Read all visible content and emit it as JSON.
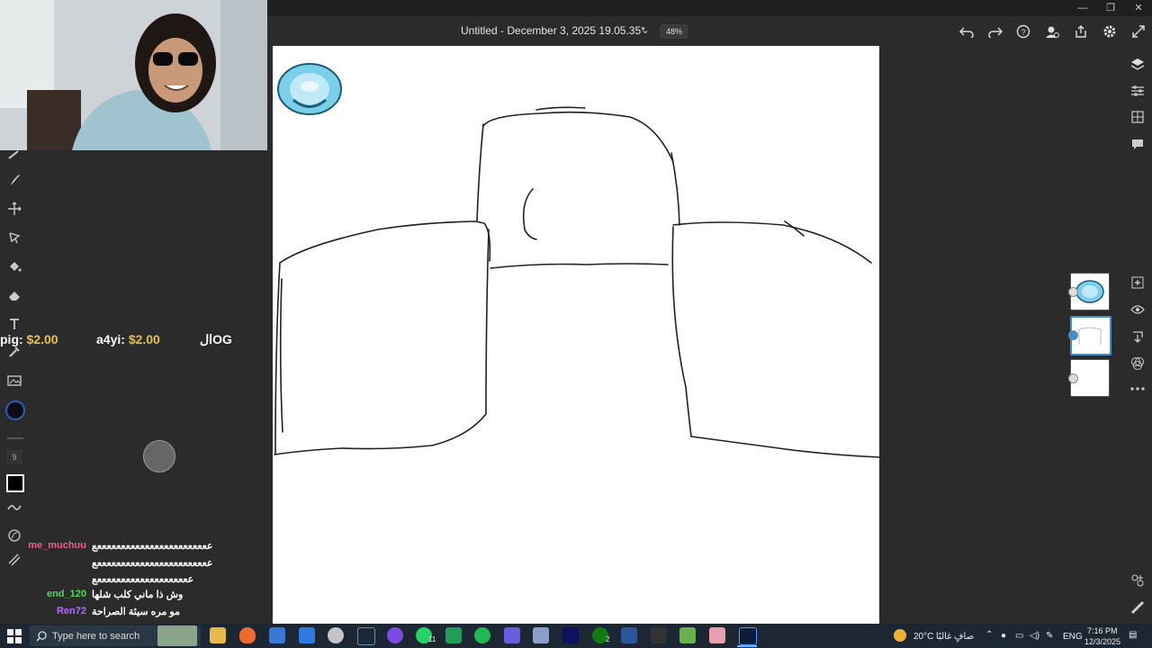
{
  "app": {
    "title": "Untitled - December 3, 2025 19.05.35*",
    "zoom": "48%"
  },
  "tools": {
    "brush_size": "9"
  },
  "donations": [
    {
      "name": "pig:",
      "amount": "$2.00"
    },
    {
      "name": "a4yi:",
      "amount": "$2.00"
    },
    {
      "name": "ال",
      "amount": "OG"
    }
  ],
  "chat": [
    {
      "user": "me_muchuu",
      "message": "ععععععععععععععععععععععععع",
      "color": "#e9608b"
    },
    {
      "user": "",
      "message": "ععععععععععععععععععععععععع",
      "color": "#e9608b"
    },
    {
      "user": "",
      "message": "ععععععععععععععععععععع",
      "color": "#e9608b"
    },
    {
      "user": "end_120",
      "message": "وش ذا ماني كلب شلها",
      "color": "#58d35a"
    },
    {
      "user": "Ren72",
      "message": "مو مره سيئة الصراحة",
      "color": "#b66bff"
    }
  ],
  "taskbar": {
    "search_placeholder": "Type here to search",
    "weather_temp": "20°C",
    "weather_desc": "صافٍ غالبًا",
    "language": "ENG",
    "time": "7:16 PM",
    "date": "12/3/2025",
    "badge_whatsapp": "11",
    "badge_xbox": "2"
  },
  "colors": {
    "accent": "#3d8fd6",
    "donation_amount": "#e8c14a",
    "canvas": "#ffffff"
  }
}
